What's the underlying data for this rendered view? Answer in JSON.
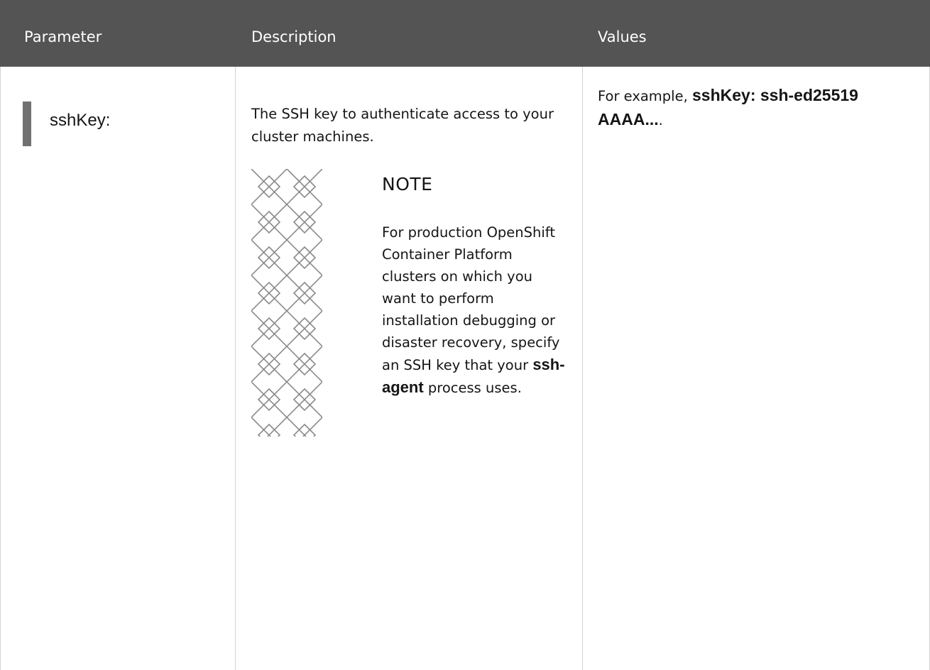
{
  "table": {
    "headers": {
      "parameter": "Parameter",
      "description": "Description",
      "values": "Values"
    },
    "row": {
      "parameter": "sshKey:",
      "description": "The SSH key to authenticate access to your cluster machines.",
      "note": {
        "title": "NOTE",
        "body_before": "For production OpenShift Container Platform clusters on which you want to perform installation debugging or disaster recovery, specify an SSH key that your ",
        "code": "ssh-agent",
        "body_after": " process uses."
      },
      "values": {
        "prefix": "For example, ",
        "code": "sshKey: ssh-ed25519 AAAA...",
        "suffix": "."
      }
    }
  },
  "colors": {
    "header_bg": "#545454",
    "header_text": "#ffffff",
    "border": "#d2d2d2",
    "param_bar": "#707070",
    "text": "#151515"
  },
  "icons": {
    "note": "note-pattern-icon"
  }
}
